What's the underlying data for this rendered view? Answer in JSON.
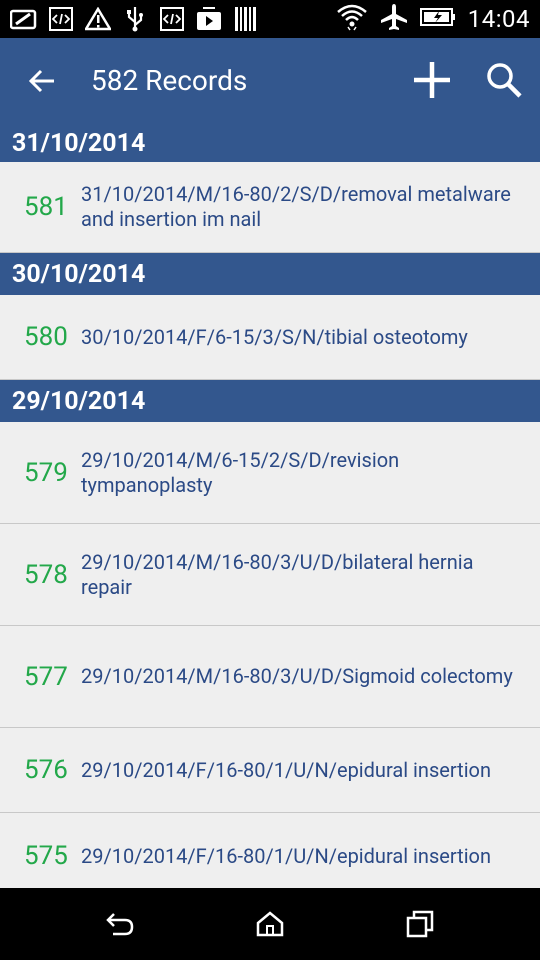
{
  "status_bar": {
    "time": "14:04",
    "left_icons": [
      "notification-icon",
      "code-icon",
      "warning-icon",
      "usb-icon",
      "code-icon",
      "media-icon",
      "barcode-icon"
    ],
    "right_icons": [
      "wifi-icon",
      "airplane-icon",
      "battery-charging-icon"
    ]
  },
  "app_bar": {
    "title": "582 Records",
    "back_icon": "back-arrow-icon",
    "add_icon": "add-icon",
    "search_icon": "search-icon"
  },
  "groups": [
    {
      "date": "31/10/2014",
      "records": [
        {
          "number": "581",
          "text": "31/10/2014/M/16-80/2/S/D/removal metalware and insertion im nail"
        }
      ]
    },
    {
      "date": "30/10/2014",
      "records": [
        {
          "number": "580",
          "text": "30/10/2014/F/6-15/3/S/N/tibial osteotomy"
        }
      ]
    },
    {
      "date": "29/10/2014",
      "records": [
        {
          "number": "579",
          "text": "29/10/2014/M/6-15/2/S/D/revision tympanoplasty"
        },
        {
          "number": "578",
          "text": "29/10/2014/M/16-80/3/U/D/bilateral hernia repair"
        },
        {
          "number": "577",
          "text": "29/10/2014/M/16-80/3/U/D/Sigmoid colectomy"
        },
        {
          "number": "576",
          "text": "29/10/2014/F/16-80/1/U/N/epidural insertion"
        },
        {
          "number": "575",
          "text": "29/10/2014/F/16-80/1/U/N/epidural insertion"
        }
      ]
    }
  ],
  "nav_bar": {
    "back_icon": "nav-back-icon",
    "home_icon": "nav-home-icon",
    "recents_icon": "nav-recents-icon"
  },
  "colors": {
    "primary": "#33578e",
    "record_number": "#23a84a",
    "record_text": "#2b4a86",
    "list_background": "#efefef"
  }
}
